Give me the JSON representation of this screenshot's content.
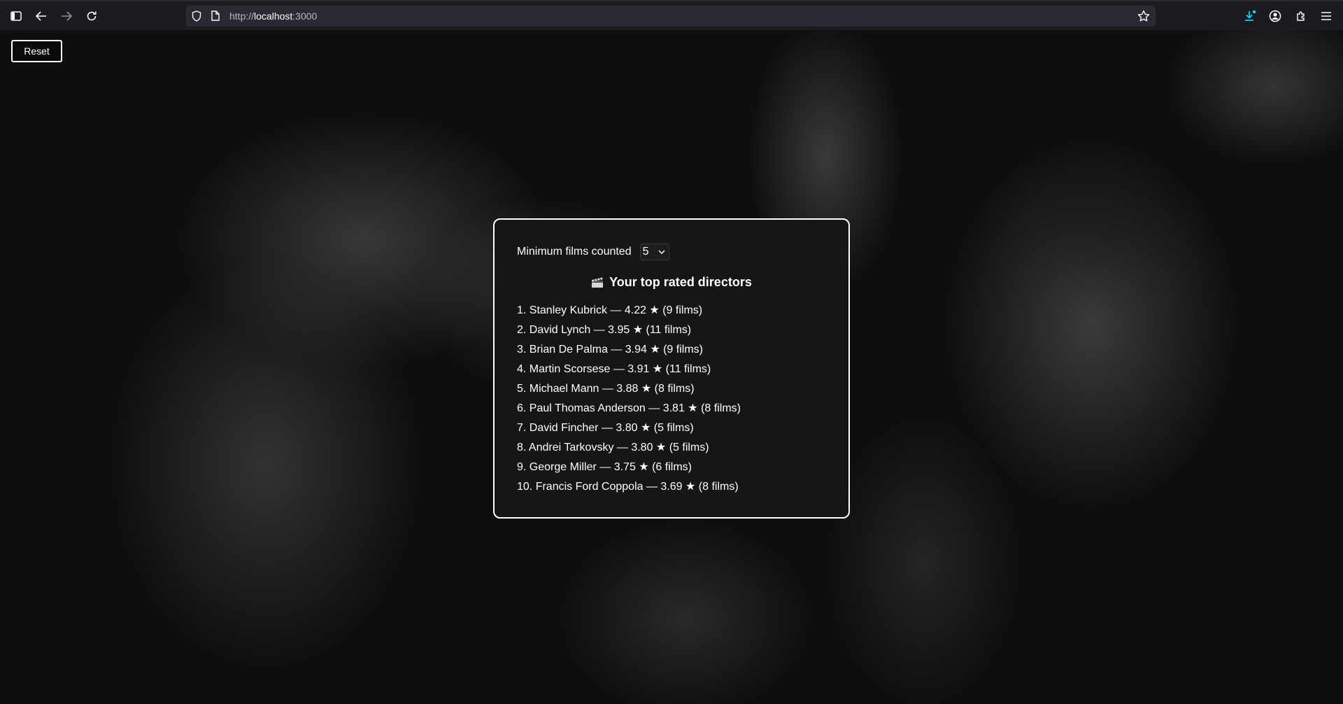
{
  "browser": {
    "url_scheme": "http://",
    "url_host": "localhost",
    "url_port": ":3000",
    "icons": [
      "sidebar-icon",
      "back-icon",
      "forward-icon",
      "reload-icon",
      "shield-icon",
      "page-icon",
      "bookmark-star-icon",
      "download-icon",
      "account-icon",
      "extensions-icon",
      "menu-icon"
    ]
  },
  "page": {
    "reset_label": "Reset",
    "filter_label": "Minimum films counted",
    "min_films_value": "5",
    "title": "Your top rated directors",
    "title_icon": "clapperboard-icon",
    "directors": [
      {
        "text": "1. Stanley Kubrick — 4.22 ★ (9 films)"
      },
      {
        "text": "2. David Lynch — 3.95 ★ (11 films)"
      },
      {
        "text": "3. Brian De Palma — 3.94 ★ (9 films)"
      },
      {
        "text": "4. Martin Scorsese — 3.91 ★ (11 films)"
      },
      {
        "text": "5. Michael Mann — 3.88 ★ (8 films)"
      },
      {
        "text": "6. Paul Thomas Anderson — 3.81 ★ (8 films)"
      },
      {
        "text": "7. David Fincher — 3.80 ★ (5 films)"
      },
      {
        "text": "8. Andrei Tarkovsky — 3.80 ★ (5 films)"
      },
      {
        "text": "9. George Miller — 3.75 ★ (6 films)"
      },
      {
        "text": "10. Francis Ford Coppola — 3.69 ★ (8 films)"
      }
    ]
  },
  "colors": {
    "download_accent": "#00ddff",
    "panel_border": "#ffffff"
  }
}
